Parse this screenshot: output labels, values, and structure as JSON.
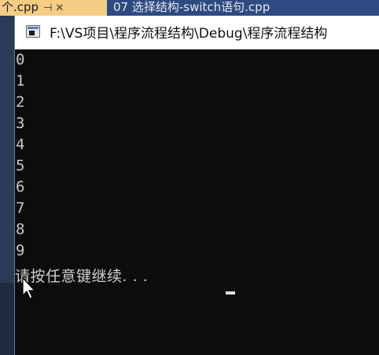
{
  "ide": {
    "active_tab": {
      "label": "个.cpp",
      "pin_icon": "pin-icon",
      "close_icon": "close-icon"
    },
    "inactive_tab": {
      "label": "07 选择结构-switch语句.cpp"
    }
  },
  "console": {
    "title": "F:\\VS项目\\程序流程结构\\Debug\\程序流程结构",
    "icon": "console-app-icon",
    "output_lines": [
      "0",
      "1",
      "2",
      "3",
      "4",
      "5",
      "6",
      "7",
      "8",
      "9"
    ],
    "prompt": "请按任意键继续. . ."
  },
  "colors": {
    "console_bg": "#0c0c0c",
    "console_text": "#c8c8c8",
    "ide_tab_active": "#f5cc84",
    "ide_tab_strip": "#2d4a82"
  }
}
